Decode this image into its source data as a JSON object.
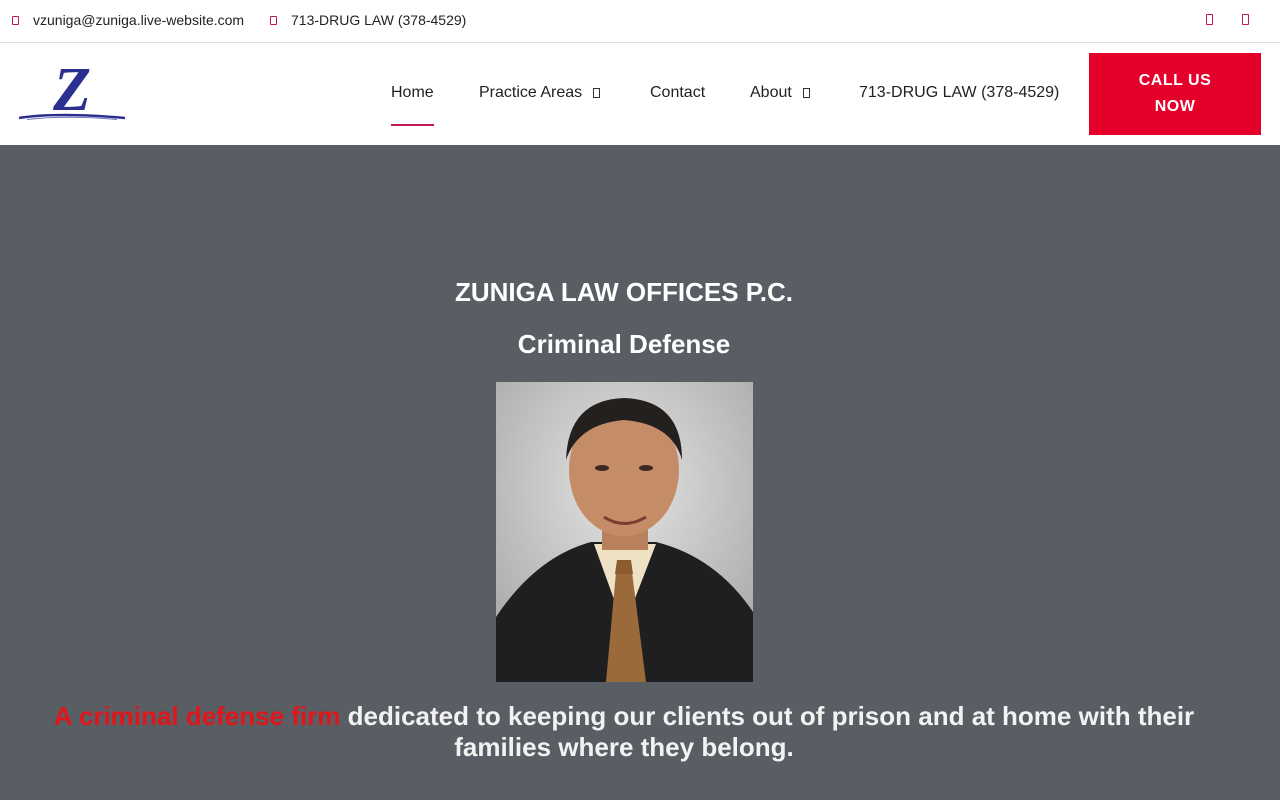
{
  "topbar": {
    "email": "vzuniga@zuniga.live-website.com",
    "phone": "713-DRUG LAW (378-4529)",
    "email_icon": "mail-icon",
    "phone_icon": "phone-icon",
    "social_icons": [
      "facebook-icon",
      "linkedin-icon"
    ]
  },
  "header": {
    "logo_letter": "Z",
    "nav": {
      "home": "Home",
      "practice_areas": "Practice Areas",
      "contact": "Contact",
      "about": "About",
      "phone": "713-DRUG LAW (378-4529)"
    },
    "cta_label": "CALL US NOW"
  },
  "hero": {
    "title": "ZUNIGA LAW OFFICES P.C.",
    "subtitle": "Criminal Defense",
    "tagline_highlight": "A criminal defense firm",
    "tagline_rest": " dedicated to keeping our clients out of prison and at home with their families where they belong."
  },
  "colors": {
    "accent": "#e4002b",
    "hero_bg": "#595d64",
    "icon_accent": "#c2185b",
    "logo_blue": "#2b2f8f"
  }
}
